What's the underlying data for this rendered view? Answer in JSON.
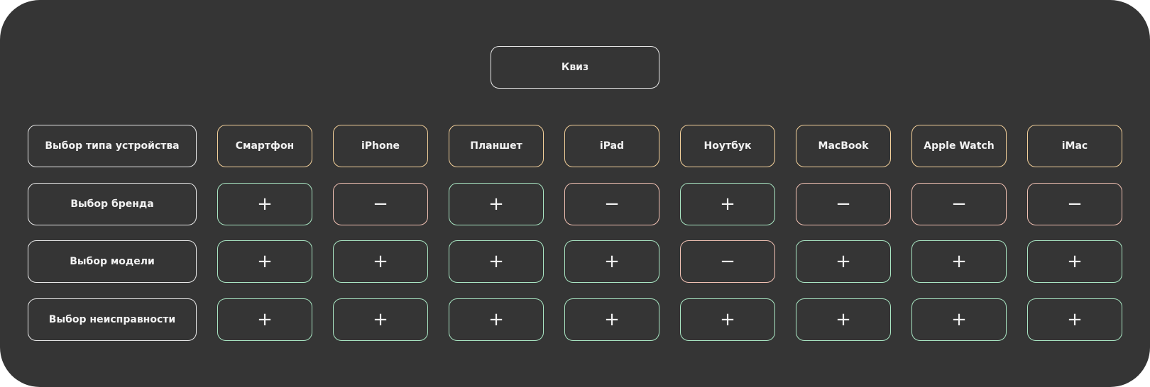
{
  "title": "Квиз",
  "sign_symbols": {
    "plus": "+",
    "minus": "−"
  },
  "colors": {
    "background": "#353535",
    "label_border": "#e8e8e8",
    "device_border": "#f3d09a",
    "plus_border": "#a9e6c3",
    "minus_border": "#f1c1b3"
  },
  "devices": [
    "Смартфон",
    "iPhone",
    "Планшет",
    "iPad",
    "Ноутбук",
    "MacBook",
    "Apple Watch",
    "iMac"
  ],
  "device_row_label": "Выбор типа устройства",
  "rows": [
    {
      "label": "Выбор бренда",
      "values": [
        "+",
        "−",
        "+",
        "−",
        "+",
        "−",
        "−",
        "−"
      ]
    },
    {
      "label": "Выбор модели",
      "values": [
        "+",
        "+",
        "+",
        "+",
        "−",
        "+",
        "+",
        "+"
      ]
    },
    {
      "label": "Выбор неисправности",
      "values": [
        "+",
        "+",
        "+",
        "+",
        "+",
        "+",
        "+",
        "+"
      ]
    }
  ]
}
